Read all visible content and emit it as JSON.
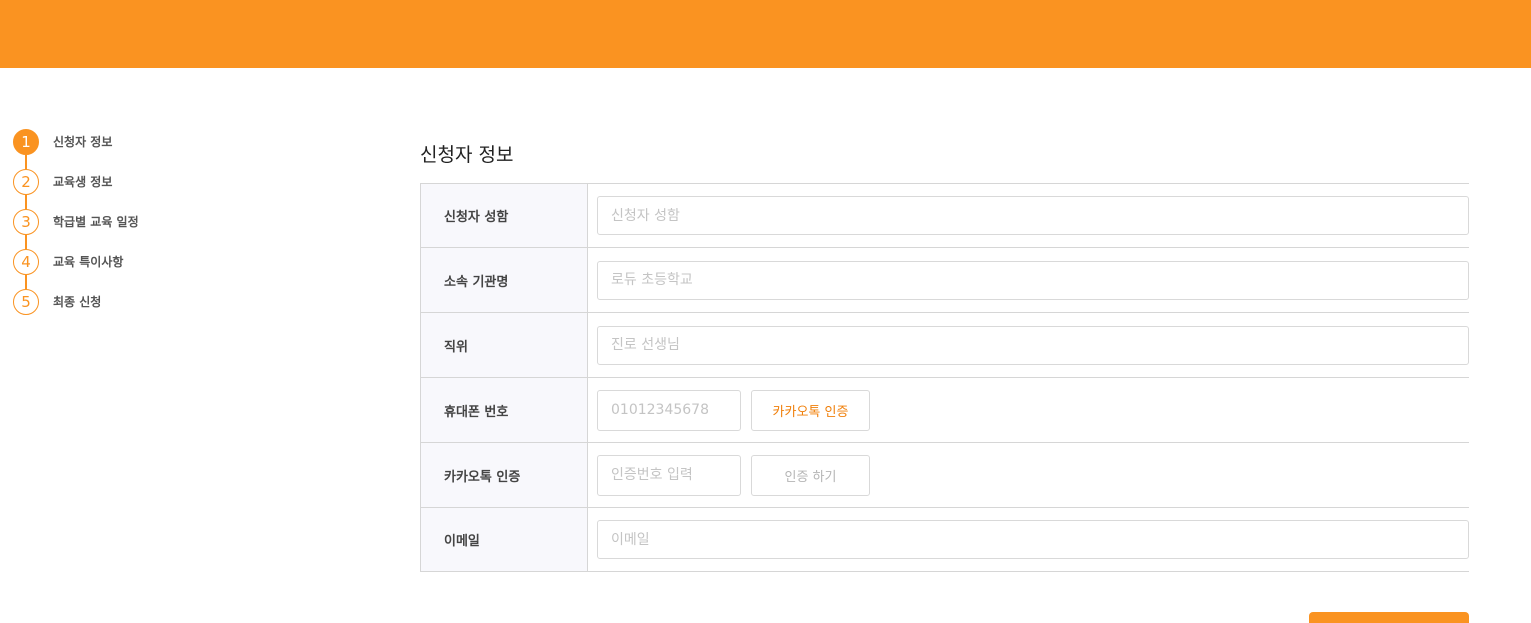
{
  "colors": {
    "accent": "#fa9321",
    "label_bg": "#f8f8fc",
    "border": "#d6d6d6"
  },
  "steps": [
    {
      "number": "1",
      "label": "신청자 정보",
      "active": true
    },
    {
      "number": "2",
      "label": "교육생 정보",
      "active": false
    },
    {
      "number": "3",
      "label": "학급별 교육 일정",
      "active": false
    },
    {
      "number": "4",
      "label": "교육 특이사항",
      "active": false
    },
    {
      "number": "5",
      "label": "최종 신청",
      "active": false
    }
  ],
  "form": {
    "title": "신청자 정보",
    "rows": {
      "name": {
        "label": "신청자 성함",
        "placeholder": "신청자 성함"
      },
      "org": {
        "label": "소속 기관명",
        "placeholder": "로듀 초등학교"
      },
      "position": {
        "label": "직위",
        "placeholder": "진로 선생님"
      },
      "phone": {
        "label": "휴대폰 번호",
        "placeholder": "01012345678",
        "button": "카카오톡 인증"
      },
      "kakao": {
        "label": "카카오톡 인증",
        "placeholder": "인증번호 입력",
        "button": "인증 하기"
      },
      "email": {
        "label": "이메일",
        "placeholder": "이메일"
      }
    }
  }
}
